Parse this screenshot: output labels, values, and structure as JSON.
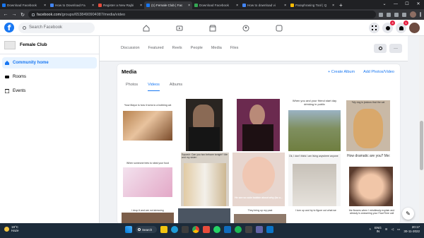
{
  "browser": {
    "tabs": [
      {
        "label": "Download Facebook",
        "color": "#1877f2",
        "active": false
      },
      {
        "label": "How to Download Fa",
        "color": "#4285f4",
        "active": false
      },
      {
        "label": "Register a New Rajbi",
        "color": "#e74c3c",
        "active": false
      },
      {
        "label": "(1) Female Club | Fac",
        "color": "#1877f2",
        "active": true
      },
      {
        "label": "Download Facebook",
        "color": "#34a853",
        "active": false
      },
      {
        "label": "How to download vi",
        "color": "#4285f4",
        "active": false
      },
      {
        "label": "Paraphrasing Tool | Q",
        "color": "#fbbc04",
        "active": false
      }
    ],
    "new_tab": "+",
    "url_domain": "facebook.com",
    "url_path": "/groups/6538490904087/media/video"
  },
  "facebook": {
    "logo": "f",
    "search_placeholder": "Search Facebook",
    "notification_badges": {
      "messenger": "4",
      "notifications": "1"
    }
  },
  "sidebar": {
    "group_name": "Female Club",
    "items": [
      {
        "label": "Community home",
        "icon": "community-icon",
        "active": true
      },
      {
        "label": "Rooms",
        "icon": "rooms-icon",
        "active": false
      },
      {
        "label": "Events",
        "icon": "events-icon",
        "active": false
      }
    ]
  },
  "group_tabs": [
    "Discussion",
    "Featured",
    "Reels",
    "People",
    "Media",
    "Files"
  ],
  "group_buttons": {
    "search": "search-icon",
    "more": "···"
  },
  "media": {
    "title": "Media",
    "create_album": "+ Create Album",
    "add_media": "Add Photos/Video",
    "tabs": [
      {
        "label": "Photos",
        "active": false
      },
      {
        "label": "Videos",
        "active": true
      },
      {
        "label": "Albums",
        "active": false
      }
    ],
    "captions": {
      "cat": "*how Mayor is how it turns to a bobbing cat",
      "friend": "When you and your friend start day drinking in public",
      "dog": "*My dog is jealous that the cat",
      "dating": "Squash: Can you two behave tonight? Me and my sister:",
      "crying": "He see so cute bobbin about why (ko u...",
      "hanger": "When someone tries to steal your food",
      "oldman": "Ok, I don't think I am living anywhere anyone",
      "baby": "How dramatic are you? Me:",
      "row3a": "I drop it and are not stressing",
      "row3b": "They bring up my past",
      "row3c": "I turn up and try to figure out what we",
      "row3d": "the flowers when I mindlessly explain and already is answering your FaceTime call"
    }
  },
  "taskbar": {
    "temp": "19°C",
    "weather": "Haze",
    "search": "Search",
    "lang": "ENG",
    "region": "IN",
    "time": "20:17",
    "date": "30-11-2022"
  }
}
